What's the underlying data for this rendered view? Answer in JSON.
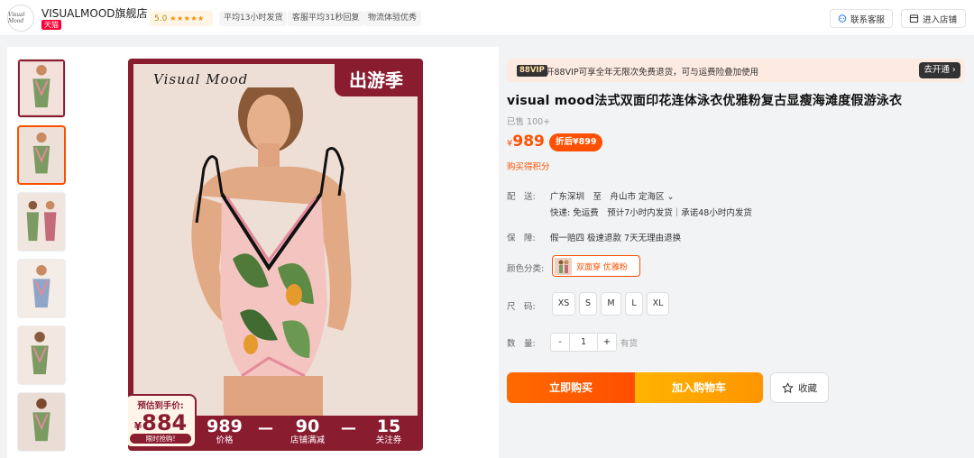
{
  "header": {
    "logo_text": "Visual Mood",
    "shop_name": "VISUALMOOD旗舰店",
    "tmall_badge": "天猫",
    "rating": "5.0",
    "tags": [
      "平均13小时发货",
      "客服平均31秒回复",
      "物流体验优秀"
    ],
    "contact_label": "联系客服",
    "enter_label": "进入店铺"
  },
  "gallery": {
    "brand_script": "Visual Mood",
    "promo_banner": "出游季",
    "badge_label": "预估到手价:",
    "badge_currency": "¥",
    "badge_price": "884",
    "badge_cta": "限时抢购!",
    "calc": [
      {
        "value": "989",
        "label": "价格"
      },
      {
        "value": "90",
        "label": "店铺满减"
      },
      {
        "value": "15",
        "label": "关注券"
      }
    ],
    "calc_ops": [
      "—",
      "—"
    ]
  },
  "vip": {
    "badge": "88VIP",
    "text": "开88VIP可享全年无限次免费退货，可与运费险叠加使用",
    "button": "去开通 ›"
  },
  "product": {
    "title": "visual mood法式双面印花连体泳衣优雅粉复古显瘦海滩度假游泳衣",
    "sold": "已售 100+",
    "currency": "¥",
    "price": "989",
    "after_coupon": "折后¥899",
    "points": "购买得积分",
    "delivery_label": "配　送:",
    "delivery_route": "广东深圳　至　舟山市 定海区",
    "delivery_detail": "快递: 免运费　预计7小时内发货｜承诺48小时内发货",
    "guarantee_label": "保　障:",
    "guarantee_value": "假一赔四 极速退款 7天无理由退换",
    "color_label": "颜色分类:",
    "color_option": "双面穿 优雅粉",
    "size_label": "尺　码:",
    "sizes": [
      "XS",
      "S",
      "M",
      "L",
      "XL"
    ],
    "qty_label": "数　量:",
    "qty_minus": "-",
    "qty_value": "1",
    "qty_plus": "+",
    "stock": "有货",
    "buy_now": "立即购买",
    "add_cart": "加入购物车",
    "favorite": "收藏"
  },
  "colors": {
    "accent": "#ff5000",
    "brand_burgundy": "#8a1c30",
    "cart_orange": "#ff9500"
  }
}
